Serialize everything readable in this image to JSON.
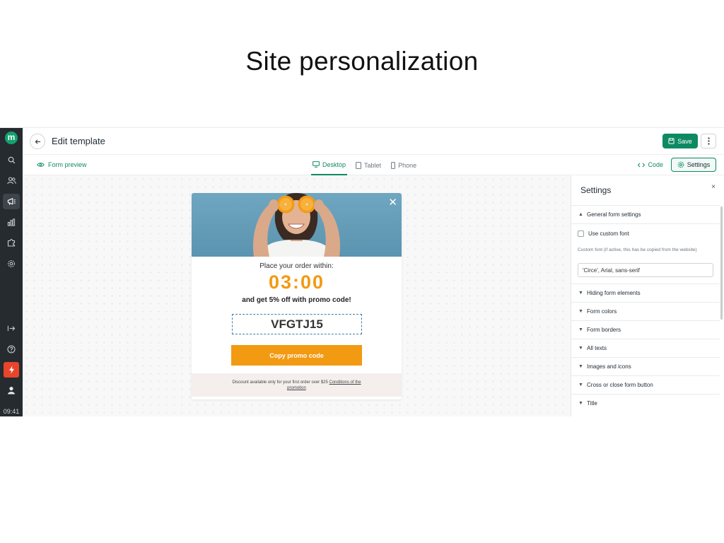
{
  "slide": {
    "title": "Site personalization"
  },
  "header": {
    "title": "Edit template",
    "save_label": "Save"
  },
  "toolbar": {
    "form_preview": "Form preview",
    "devices": [
      "Desktop",
      "Tablet",
      "Phone"
    ],
    "code_label": "Code",
    "settings_label": "Settings"
  },
  "sidebar": {
    "time": "09:41"
  },
  "popup": {
    "order_text": "Place your order within:",
    "timer": "03:00",
    "offer_text": "and get 5% off with promo code!",
    "promo_code": "VFGTJ15",
    "copy_button": "Copy promo code",
    "footer_text": "Discount available only for your first order over $25",
    "footer_link": "Conditions of the promotion",
    "close_glyph": "✕"
  },
  "settings": {
    "title": "Settings",
    "close_glyph": "×",
    "general_section": "General form settings",
    "use_custom_font": "Use custom font",
    "custom_font_label": "Custom font (if active, this has be copied from the website)",
    "custom_font_value": "'Circe', Arial, sans-serif",
    "sections": [
      "Hiding form elements",
      "Form colors",
      "Form borders",
      "All texts",
      "Images and icons",
      "Cross or close form button",
      "Title"
    ]
  },
  "colors": {
    "brand": "#0e8a63",
    "accent": "#f29a12",
    "rail": "#262b30",
    "bolt": "#e8452b"
  }
}
